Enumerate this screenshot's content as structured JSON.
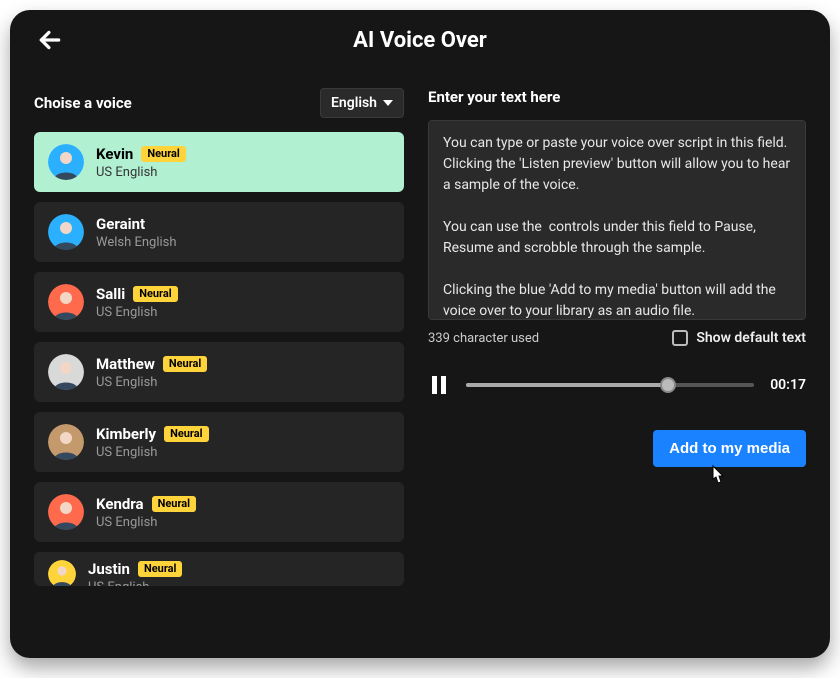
{
  "header": {
    "title": "AI Voice Over"
  },
  "left": {
    "label": "Choise a voice",
    "language": "English"
  },
  "voices": [
    {
      "name": "Kevin",
      "sub": "US English",
      "badge": "Neural",
      "avatarBg": "#2bb0ff",
      "selected": true
    },
    {
      "name": "Geraint",
      "sub": "Welsh English",
      "badge": null,
      "avatarBg": "#2bb0ff",
      "selected": false
    },
    {
      "name": "Salli",
      "sub": "US English",
      "badge": "Neural",
      "avatarBg": "#ff6a4d",
      "selected": false
    },
    {
      "name": "Matthew",
      "sub": "US English",
      "badge": "Neural",
      "avatarBg": "#d9d9d9",
      "selected": false
    },
    {
      "name": "Kimberly",
      "sub": "US English",
      "badge": "Neural",
      "avatarBg": "#c49a6c",
      "selected": false
    },
    {
      "name": "Kendra",
      "sub": "US English",
      "badge": "Neural",
      "avatarBg": "#ff6a4d",
      "selected": false
    },
    {
      "name": "Justin",
      "sub": "US English",
      "badge": "Neural",
      "avatarBg": "#ffd43b",
      "selected": false
    }
  ],
  "right": {
    "label": "Enter your text here",
    "text": "You can type or paste your voice over script in this field. Clicking the 'Listen preview' button will allow you to hear a sample of the voice.\n\nYou can use the  controls under this field to Pause, Resume and scrobble through the sample.\n\nClicking the blue 'Add to my media' button will add the voice over to your library as an audio file.",
    "charCount": "339 character used",
    "showDefaultLabel": "Show default text",
    "time": "00:17",
    "progressPct": 70,
    "cta": "Add to my media"
  }
}
